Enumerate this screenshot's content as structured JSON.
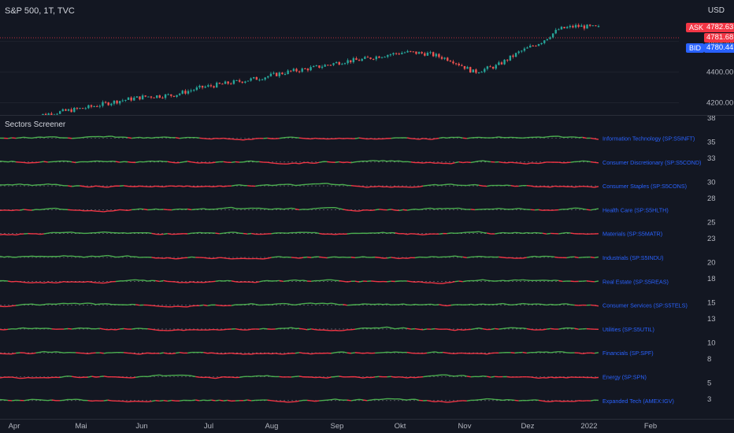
{
  "chart": {
    "title": "S&P 500, 1T, TVC",
    "currency": "USD",
    "indicator_title": "Sectors Screener",
    "price_axis_ticks": [
      "4600.00",
      "4400.00",
      "4200.00"
    ],
    "indicator_axis_ticks": [
      "38",
      "35",
      "33",
      "30",
      "28",
      "25",
      "23",
      "20",
      "18",
      "15",
      "13",
      "10",
      "8",
      "5",
      "3"
    ],
    "time_axis_ticks": [
      "Apr",
      "Mai",
      "Jun",
      "Jul",
      "Aug",
      "Sep",
      "Okt",
      "Nov",
      "Dez",
      "2022",
      "Feb"
    ],
    "price_tags": {
      "ask_label": "ASK",
      "ask_value": "4782.63",
      "last_value": "4781.68",
      "bid_label": "BID",
      "bid_value": "4780.44"
    },
    "colors": {
      "background": "#131722",
      "up": "#26a69a",
      "down": "#ef5350",
      "line_up": "#4caf50",
      "line_down": "#f23645",
      "label_blue": "#2962ff",
      "ask_red": "#f23645",
      "text": "#b2b5be"
    }
  },
  "chart_data": {
    "type": "line",
    "series_name": "S&P 500",
    "y_range": [
      4100,
      4850
    ],
    "price_path": [
      [
        0,
        4110
      ],
      [
        0.05,
        4140
      ],
      [
        0.1,
        4170
      ],
      [
        0.15,
        4210
      ],
      [
        0.2,
        4240
      ],
      [
        0.25,
        4250
      ],
      [
        0.3,
        4300
      ],
      [
        0.35,
        4330
      ],
      [
        0.4,
        4360
      ],
      [
        0.45,
        4400
      ],
      [
        0.5,
        4430
      ],
      [
        0.55,
        4470
      ],
      [
        0.58,
        4480
      ],
      [
        0.62,
        4510
      ],
      [
        0.66,
        4530
      ],
      [
        0.7,
        4520
      ],
      [
        0.74,
        4480
      ],
      [
        0.78,
        4400
      ],
      [
        0.82,
        4440
      ],
      [
        0.86,
        4530
      ],
      [
        0.9,
        4600
      ],
      [
        0.93,
        4680
      ],
      [
        0.96,
        4700
      ],
      [
        1.0,
        4690
      ]
    ],
    "sectors": [
      {
        "name": "Information Technology (SP:S5INFT)",
        "trend": "down"
      },
      {
        "name": "Consumer Discretionary (SP:S5COND)",
        "trend": "up"
      },
      {
        "name": "Consumer Staples (SP:S5CONS)",
        "trend": "up"
      },
      {
        "name": "Health Care (SP:S5HLTH)",
        "trend": "down"
      },
      {
        "name": "Materials (SP:S5MATR)",
        "trend": "up"
      },
      {
        "name": "Industrials (SP:S5INDU)",
        "trend": "up"
      },
      {
        "name": "Real Estate (SP:S5REAS)",
        "trend": "down"
      },
      {
        "name": "Consumer Services (SP:S5TELS)",
        "trend": "down"
      },
      {
        "name": "Utilities (SP:S5UTIL)",
        "trend": "up"
      },
      {
        "name": "Financials (SP:SPF)",
        "trend": "up"
      },
      {
        "name": "Energy (SP:SPN)",
        "trend": "up"
      },
      {
        "name": "Expanded Tech (AMEX:IGV)",
        "trend": "down"
      }
    ]
  }
}
